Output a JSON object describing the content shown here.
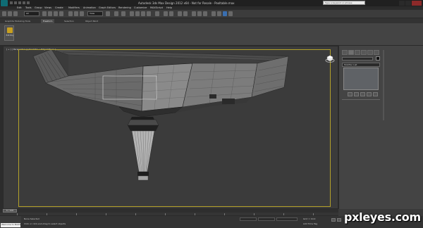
{
  "window": {
    "title": "Autodesk 3ds Max Design 2012 x64 - Not for Resale - Pooltable.max",
    "search_placeholder": "Type a keyword or phrase"
  },
  "menu": [
    "Edit",
    "Tools",
    "Group",
    "Views",
    "Create",
    "Modifiers",
    "Animation",
    "Graph Editors",
    "Rendering",
    "Customize",
    "MAXScript",
    "Help"
  ],
  "toolbar": {
    "selection_set": "All",
    "coordinate_system": "View"
  },
  "ribbon": {
    "tabs": [
      "Graphite Modeling Tools",
      "Freeform",
      "Selection",
      "Object Paint"
    ],
    "active_tab": "Freeform",
    "edit_poly_label": "Edit Poly"
  },
  "viewport": {
    "label": "[ + ] [ Perspective ] [ Realistic + Edged Faces ]"
  },
  "command_panel": {
    "modifier_list": "Modifier List"
  },
  "timeline": {
    "frame_label": "0 / 100"
  },
  "status": {
    "listener_text": "Welcome to MAXScript",
    "selection": "None Selected",
    "prompt": "Click or click-and-drag to select objects",
    "grid": "Grid = 10.0",
    "add_time_tag": "Add Time Tag"
  },
  "watermark": "pxleyes.com",
  "colors": {
    "safe_frame": "#b3a12a",
    "viewport_bg": "#3b3b3b",
    "accent_blue": "#3a6fb0"
  }
}
